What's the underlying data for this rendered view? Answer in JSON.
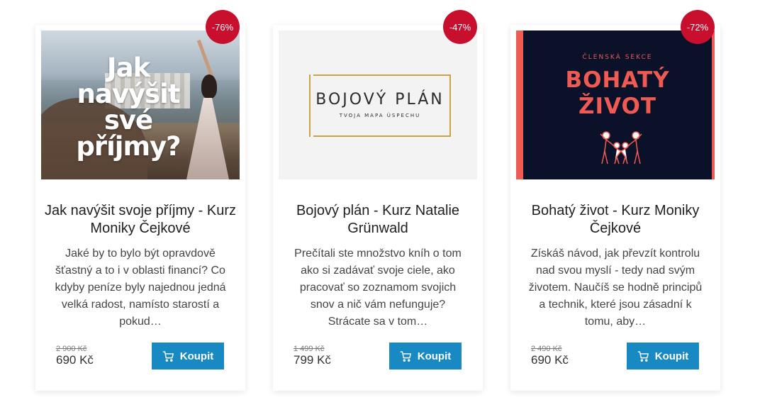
{
  "cards": [
    {
      "badge": "-76%",
      "image_text": [
        "Jak",
        "navýšit",
        "své",
        "příjmy?"
      ],
      "title": "Jak navýšit svoje příjmy - Kurz Moniky Čejkové",
      "description": "Jaké by to bylo být opravdově šťastný a to i v oblasti financí? Co kdyby peníze byly najednou jedná velká radost, namísto starostí a pokud…",
      "old_price": "2 900 Kč",
      "price": "690 Kč",
      "button_label": "Koupit"
    },
    {
      "badge": "-47%",
      "image_title": "BOJOVÝ PLÁN",
      "image_subtitle": "TVOJA MAPA ÚSPECHU",
      "title": "Bojový plán - Kurz Natalie Grünwald",
      "description": "Prečítali ste množstvo kníh o tom ako si zadávať svoje ciele, ako pracovať so zoznamom svojich snov a nič vám nefunguje? Strácate sa v tom…",
      "old_price": "1 499 Kč",
      "price": "799 Kč",
      "button_label": "Koupit"
    },
    {
      "badge": "-72%",
      "image_eyebrow": "ČLENSKÁ SEKCE",
      "image_title": "BOHATÝ ŽIVOT",
      "title": "Bohatý život - Kurz Moniky Čejkové",
      "description": "Získáš návod, jak převzít kontrolu nad svou myslí - tedy nad svým životem. Naučíš se hodně principů a technik, které jsou zásadní k tomu, aby…",
      "old_price": "2 490 Kč",
      "price": "690 Kč",
      "button_label": "Koupit"
    }
  ],
  "colors": {
    "badge": "#c8102e",
    "button": "#1989c4",
    "bohaty_accent": "#ef5a52",
    "bohaty_bg": "#0b1129",
    "bojovy_gold": "#c9a444"
  },
  "icons": {
    "button_icon": "cart-icon"
  }
}
